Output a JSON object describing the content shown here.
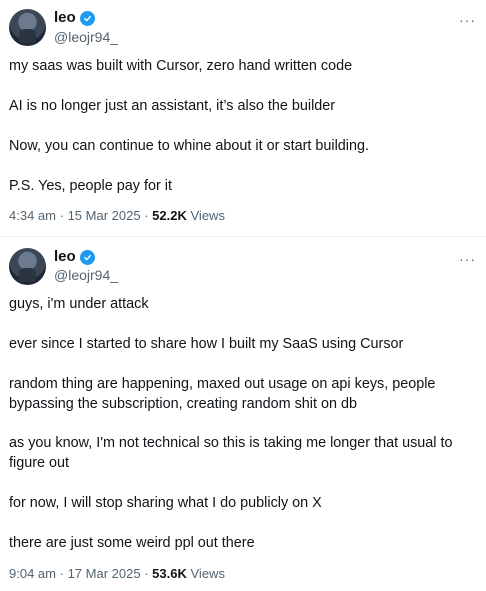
{
  "tweets": [
    {
      "name": "leo",
      "handle": "@leojr94_",
      "more": "···",
      "lines": [
        "my saas was built with Cursor, zero hand written code",
        "AI is no longer just an assistant, it’s also the builder",
        "Now, you can continue to whine about it or start building.",
        "P.S. Yes, people pay for it"
      ],
      "time": "4:34 am",
      "date": "15 Mar 2025",
      "views_count": "52.2K",
      "views_label": "Views"
    },
    {
      "name": "leo",
      "handle": "@leojr94_",
      "more": "···",
      "lines": [
        "guys, i'm under attack",
        "ever since I started to share how I built my SaaS using Cursor",
        "random thing are happening, maxed out usage on api keys, people",
        "bypassing the subscription, creating random shit on db",
        "as you know, I'm not technical so this is taking me longer that usual to",
        "figure out",
        "for now, I will stop sharing what I do publicly on X",
        "there are just some weird ppl out there"
      ],
      "time": "9:04 am",
      "date": "17 Mar 2025",
      "views_count": "53.6K",
      "views_label": "Views"
    }
  ],
  "separator": "·",
  "colors": {
    "verified": "#1d9bf0",
    "secondary_text": "#536471",
    "primary_text": "#0f1419"
  }
}
